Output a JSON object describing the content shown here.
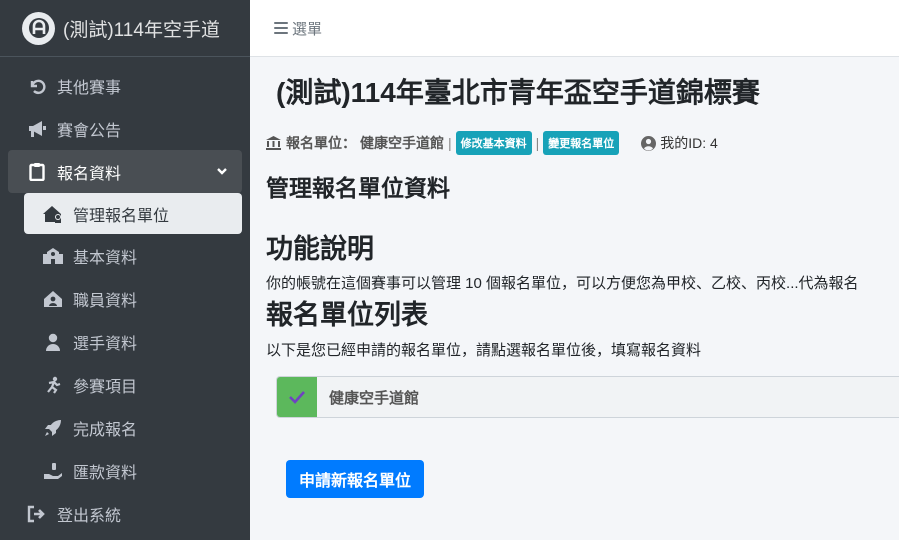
{
  "brand": {
    "title": "(測試)114年空手道"
  },
  "header": {
    "menu_label": "選單"
  },
  "sidebar": {
    "items": [
      {
        "label": "其他賽事",
        "icon": "undo-icon"
      },
      {
        "label": "賽會公告",
        "icon": "bullhorn-icon"
      },
      {
        "label": "報名資料",
        "icon": "clipboard-icon"
      },
      {
        "label": "管理報名單位",
        "icon": "house-user-icon"
      },
      {
        "label": "基本資料",
        "icon": "school-icon"
      },
      {
        "label": "職員資料",
        "icon": "house-staff-icon"
      },
      {
        "label": "選手資料",
        "icon": "user-icon"
      },
      {
        "label": "參賽項目",
        "icon": "running-icon"
      },
      {
        "label": "完成報名",
        "icon": "rocket-icon"
      },
      {
        "label": "匯款資料",
        "icon": "hand-coin-icon"
      },
      {
        "label": "登出系統",
        "icon": "sign-out-icon"
      }
    ]
  },
  "main": {
    "page_title": "(測試)114年臺北市青年盃空手道錦標賽",
    "unit_label": "報名單位：",
    "unit_name": "健康空手道館",
    "separator": "|",
    "edit_basic_badge": "修改基本資料",
    "change_unit_badge": "變更報名單位",
    "my_id": "我的ID: 4",
    "manage_heading": "管理報名單位資料",
    "function_heading": "功能說明",
    "function_text": "你的帳號在這個賽事可以管理 10 個報名單位，可以方便您為甲校、乙校、丙校...代為報名",
    "list_heading": "報名單位列表",
    "list_text": "以下是您已經申請的報名單位，請點選報名單位後，填寫報名資料",
    "units": [
      {
        "name": "健康空手道館"
      }
    ],
    "apply_button": "申請新報名單位"
  },
  "colors": {
    "sidebar_bg": "#343a40",
    "badge": "#17a2b8",
    "primary": "#007bff",
    "success": "#5cb85c",
    "active_item_bg": "#e9ecef"
  }
}
